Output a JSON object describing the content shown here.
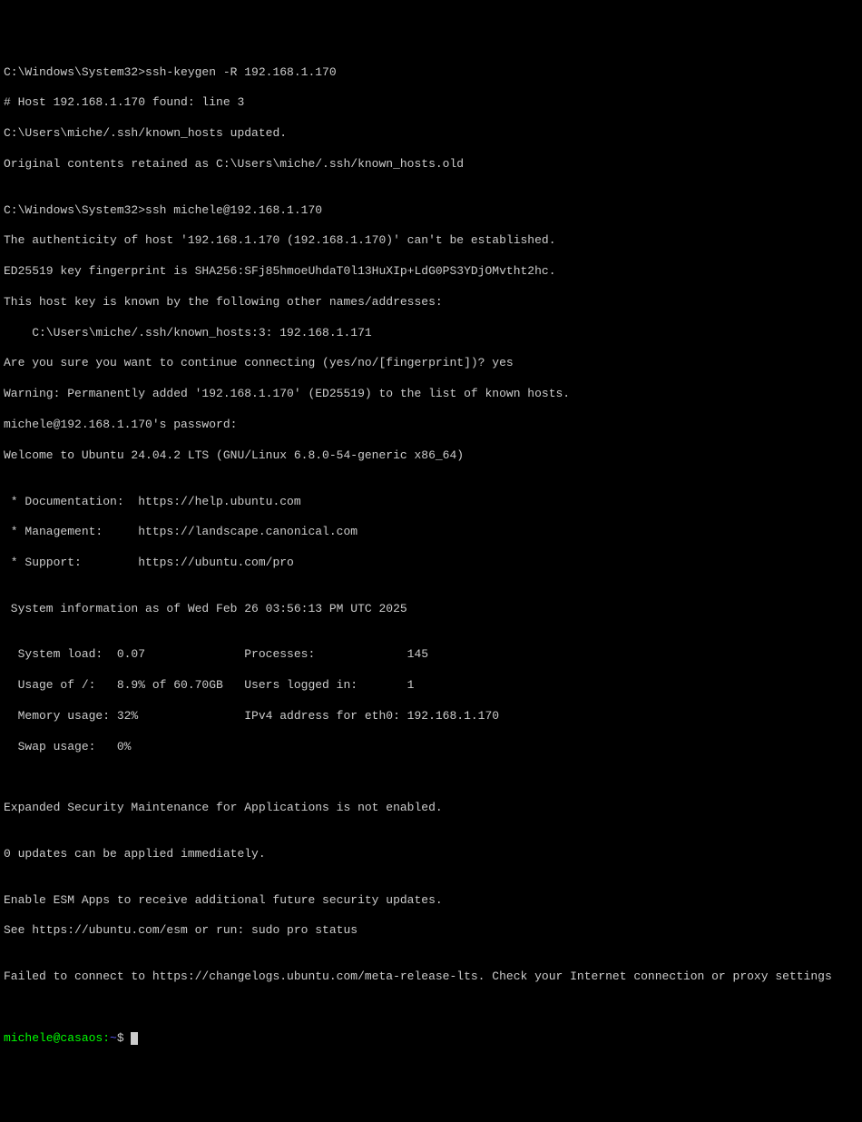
{
  "lines": {
    "l1": "C:\\Windows\\System32>ssh-keygen -R 192.168.1.170",
    "l2": "# Host 192.168.1.170 found: line 3",
    "l3": "C:\\Users\\miche/.ssh/known_hosts updated.",
    "l4": "Original contents retained as C:\\Users\\miche/.ssh/known_hosts.old",
    "l5": "",
    "l6": "C:\\Windows\\System32>ssh michele@192.168.1.170",
    "l7": "The authenticity of host '192.168.1.170 (192.168.1.170)' can't be established.",
    "l8": "ED25519 key fingerprint is SHA256:SFj85hmoeUhdaT0l13HuXIp+LdG0PS3YDjOMvtht2hc.",
    "l9": "This host key is known by the following other names/addresses:",
    "l10": "    C:\\Users\\miche/.ssh/known_hosts:3: 192.168.1.171",
    "l11": "Are you sure you want to continue connecting (yes/no/[fingerprint])? yes",
    "l12": "Warning: Permanently added '192.168.1.170' (ED25519) to the list of known hosts.",
    "l13": "michele@192.168.1.170's password:",
    "l14": "Welcome to Ubuntu 24.04.2 LTS (GNU/Linux 6.8.0-54-generic x86_64)",
    "l15": "",
    "l16": " * Documentation:  https://help.ubuntu.com",
    "l17": " * Management:     https://landscape.canonical.com",
    "l18": " * Support:        https://ubuntu.com/pro",
    "l19": "",
    "l20": " System information as of Wed Feb 26 03:56:13 PM UTC 2025",
    "l21": "",
    "l22": "  System load:  0.07              Processes:             145",
    "l23": "  Usage of /:   8.9% of 60.70GB   Users logged in:       1",
    "l24": "  Memory usage: 32%               IPv4 address for eth0: 192.168.1.170",
    "l25": "  Swap usage:   0%",
    "l26": "",
    "l27": "",
    "l28": "Expanded Security Maintenance for Applications is not enabled.",
    "l29": "",
    "l30": "0 updates can be applied immediately.",
    "l31": "",
    "l32": "Enable ESM Apps to receive additional future security updates.",
    "l33": "See https://ubuntu.com/esm or run: sudo pro status",
    "l34": "",
    "l35": "Failed to connect to https://changelogs.ubuntu.com/meta-release-lts. Check your Internet connection or proxy settings",
    "l36": "",
    "l37": ""
  },
  "prompt": {
    "user": "michele@casaos",
    "sep": ":",
    "path": "~",
    "dollar": "$"
  }
}
